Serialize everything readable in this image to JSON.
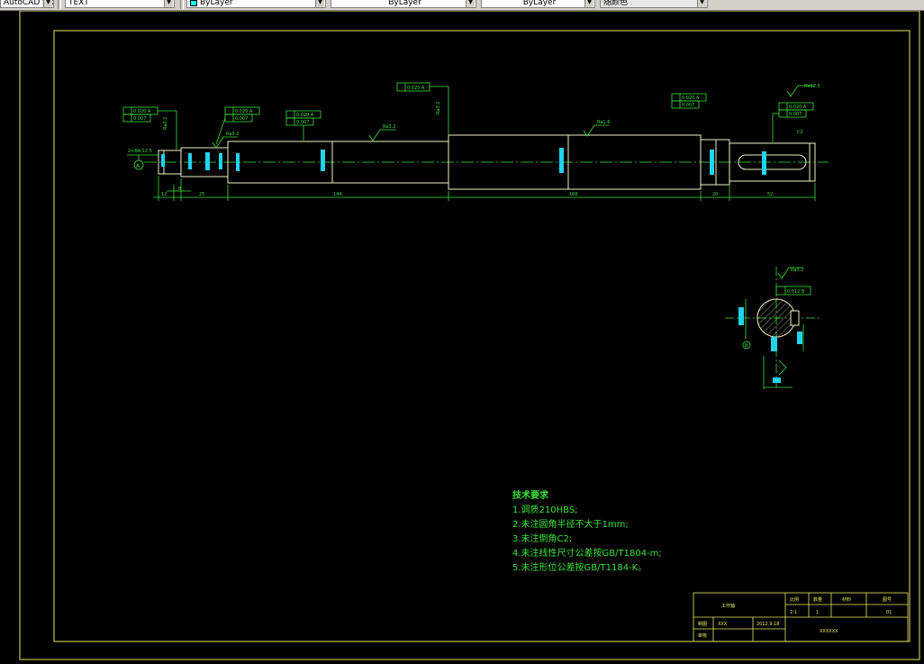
{
  "toolbar": {
    "combo1": "AutoCAD 经典",
    "combo2": "TEXT",
    "layer_color": "ByLayer",
    "layer_linetype": "ByLayer",
    "layer_lineweight": "ByLayer",
    "plot_style": "随颜色"
  },
  "dims": {
    "d_12": "12",
    "d_8": "8",
    "d_25": "25",
    "d_144": "144",
    "d_166": "166",
    "d_20": "20",
    "d_52": "52",
    "center_hole": "2×B4/12.5",
    "datum": "A",
    "chamfer": "C2"
  },
  "tolerances": {
    "t1a": "0.020 A",
    "t1b": "0.007",
    "t2a": "0.020 A",
    "t2b": "0.007",
    "t3a": "0.020 A",
    "t3b": "0.007",
    "t4": "0.025 A",
    "t5a": "0.020 A",
    "t5b": "0.007",
    "t6a": "0.020 A",
    "t6b": "0.007",
    "t7": "0.012 B"
  },
  "roughness": {
    "r1": "Ra3.2",
    "r2": "Ra3.2",
    "r3": "Ra1.6",
    "r4": "Ra3.2",
    "r5": "Ra3.2",
    "r6": "Ra12.5",
    "r7": "Ra3.2"
  },
  "section": {
    "datum": "B"
  },
  "requirements": {
    "title": "技术要求",
    "items": [
      "1.调质210HBS;",
      "2.未注圆角半径不大于1mm;",
      "3.未注倒角C2;",
      "4.未注线性尺寸公差按GB/T1804-m;",
      "5.未注形位公差按GB/T1184-K。"
    ]
  },
  "title_block": {
    "part_name": "工作轴",
    "h_scale": "比例",
    "h_qty": "数量",
    "h_material": "材料",
    "h_drawing_no": "图号",
    "scale": "2:1",
    "qty": "1",
    "material": "",
    "drawing_no": "01",
    "drawn_label": "制图",
    "drawn_by": "XXX",
    "date": "2012.9.18",
    "check_label": "审核",
    "school": "XXXXXX"
  },
  "colors": {
    "background": "#000000",
    "frame": "#e8e860",
    "dimension": "#3ae23a",
    "part_outline": "#f0f0c0",
    "centerline": "#3ae23a",
    "hidden": "#22d3ee"
  }
}
